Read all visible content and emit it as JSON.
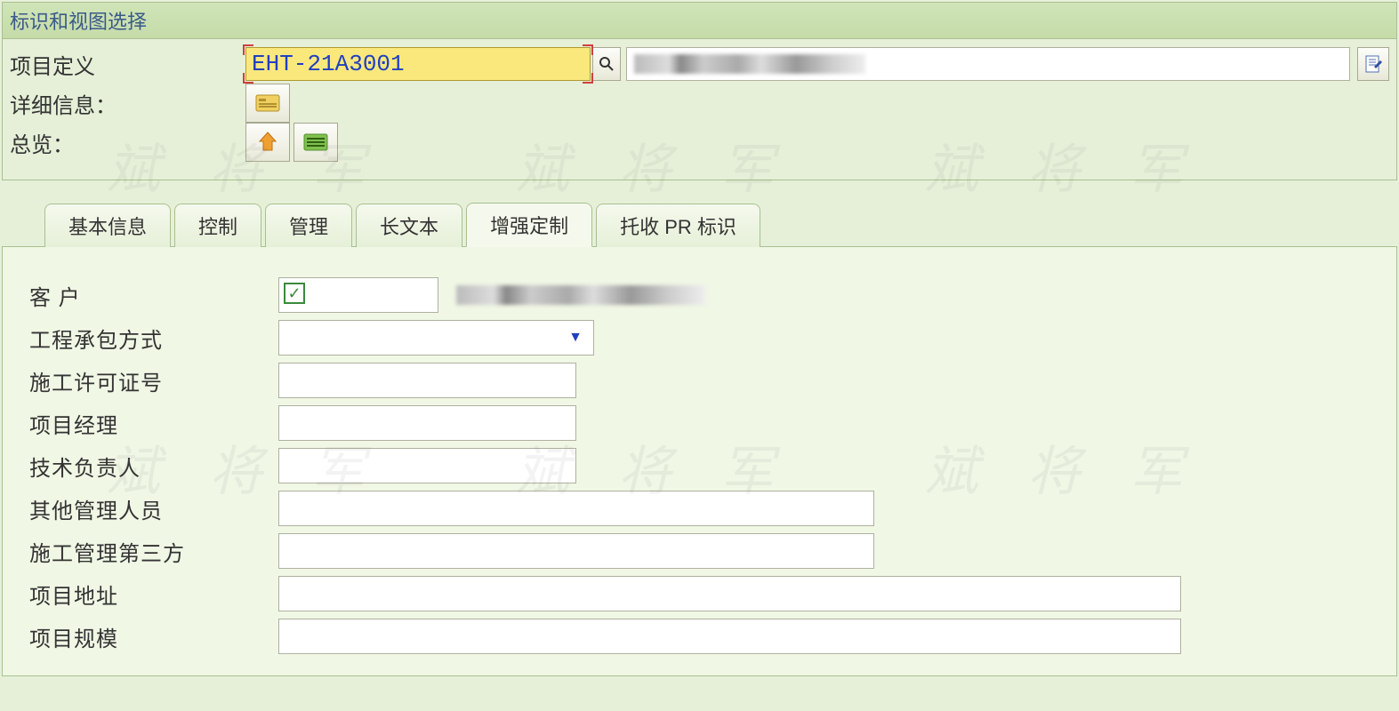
{
  "watermark": "斌 将 军",
  "panel": {
    "title": "标识和视图选择",
    "project_def_label": "项目定义",
    "project_def_value": "EHT-21A3001",
    "detail_label": "详细信息：",
    "overview_label": "总览："
  },
  "tabs": {
    "basic": "基本信息",
    "control": "控制",
    "manage": "管理",
    "longtext": "长文本",
    "enhance": "增强定制",
    "tuoshou": "托收 PR 标识"
  },
  "fields": {
    "customer": "客 户",
    "contract_type": "工程承包方式",
    "permit_no": "施工许可证号",
    "pm": "项目经理",
    "tech_lead": "技术负责人",
    "other_mgmt": "其他管理人员",
    "third_party": "施工管理第三方",
    "address": "项目地址",
    "scale": "项目规模"
  },
  "values": {
    "customer": "",
    "contract_type": "",
    "permit_no": "",
    "pm": "",
    "tech_lead": "",
    "other_mgmt": "",
    "third_party": "",
    "address": "",
    "scale": ""
  }
}
